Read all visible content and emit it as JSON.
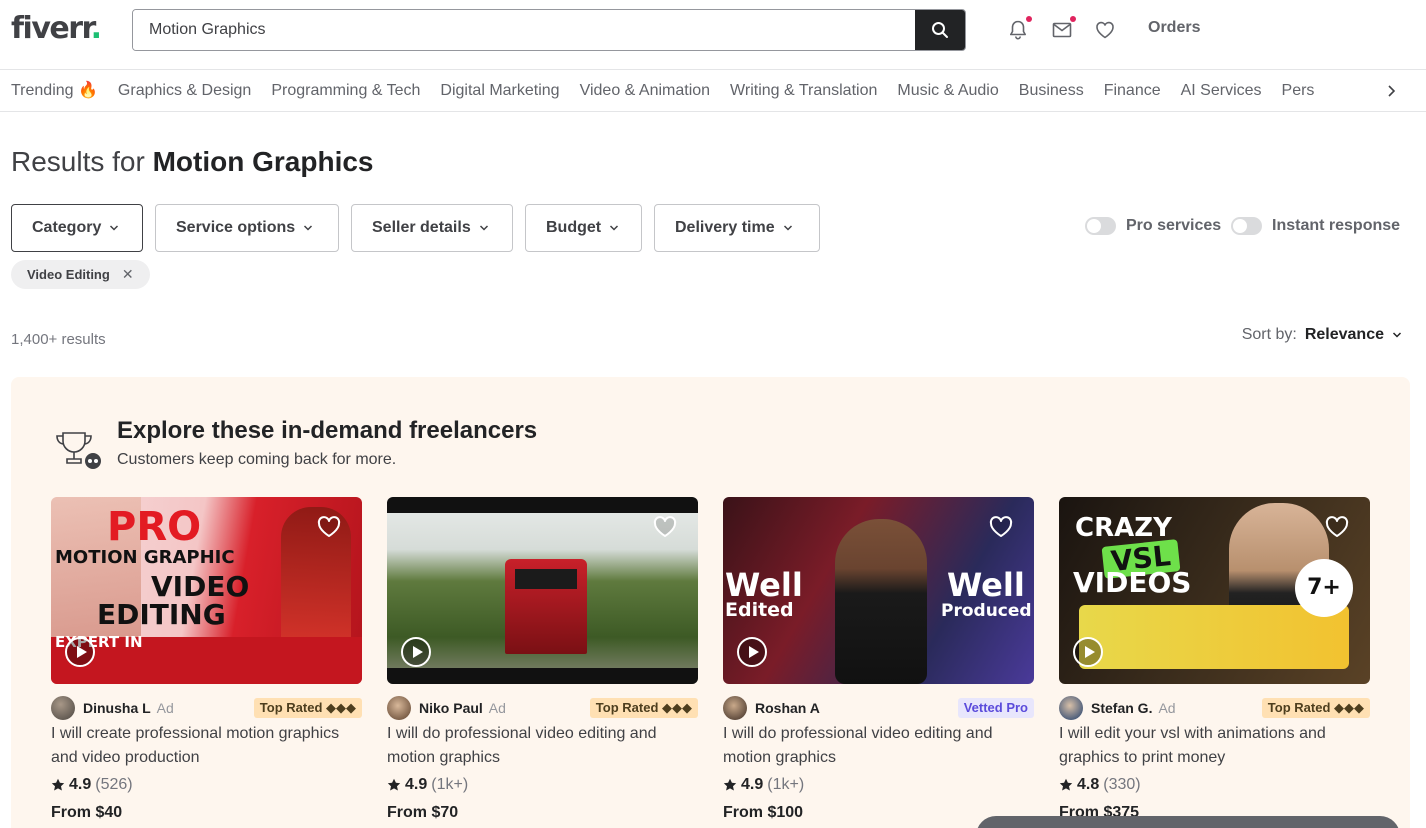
{
  "header": {
    "logo": "fiverr",
    "logo_dot": ".",
    "search_value": "Motion Graphics",
    "orders_label": "Orders",
    "icons": [
      "bell-icon",
      "mail-icon",
      "heart-icon"
    ]
  },
  "categories": [
    "Trending 🔥",
    "Graphics & Design",
    "Programming & Tech",
    "Digital Marketing",
    "Video & Animation",
    "Writing & Translation",
    "Music & Audio",
    "Business",
    "Finance",
    "AI Services",
    "Pers"
  ],
  "results": {
    "prefix": "Results for",
    "query": "Motion Graphics",
    "count": "1,400+ results",
    "sort_label": "Sort by:",
    "sort_value": "Relevance"
  },
  "filters": [
    "Category",
    "Service options",
    "Seller details",
    "Budget",
    "Delivery time"
  ],
  "toggles": [
    "Pro services",
    "Instant response"
  ],
  "chip": {
    "label": "Video Editing"
  },
  "panel": {
    "title": "Explore these in-demand freelancers",
    "subtitle": "Customers keep coming back for more."
  },
  "cards": [
    {
      "seller": "Dinusha L",
      "ad": "Ad",
      "badge": "Top Rated ◆◆◆",
      "badge_type": "top",
      "title": "I will create professional motion graphics and video production",
      "rating": "4.9",
      "reviews": "(526)",
      "price": "From $40",
      "thumb_text": [
        "PRO",
        "MOTION GRAPHIC",
        "VIDEO",
        "EDITING",
        "EXPERT IN"
      ]
    },
    {
      "seller": "Niko Paul",
      "ad": "Ad",
      "badge": "Top Rated ◆◆◆",
      "badge_type": "top",
      "title": "I will do professional video editing and motion graphics",
      "rating": "4.9",
      "reviews": "(1k+)",
      "price": "From $70",
      "thumb_text": []
    },
    {
      "seller": "Roshan A",
      "ad": "",
      "badge": "Vetted Pro",
      "badge_type": "vetted",
      "title": "I will do professional video editing and motion graphics",
      "rating": "4.9",
      "reviews": "(1k+)",
      "price": "From $100",
      "thumb_text": [
        "Well",
        "Edited",
        "Well",
        "Produced"
      ]
    },
    {
      "seller": "Stefan G.",
      "ad": "Ad",
      "badge": "Top Rated ◆◆◆",
      "badge_type": "top",
      "title": "I will edit your vsl with animations and graphics to print money",
      "rating": "4.8",
      "reviews": "(330)",
      "price": "From $375",
      "thumb_text": [
        "CRAZY",
        "VSL",
        "VIDEOS",
        "7+"
      ]
    }
  ]
}
